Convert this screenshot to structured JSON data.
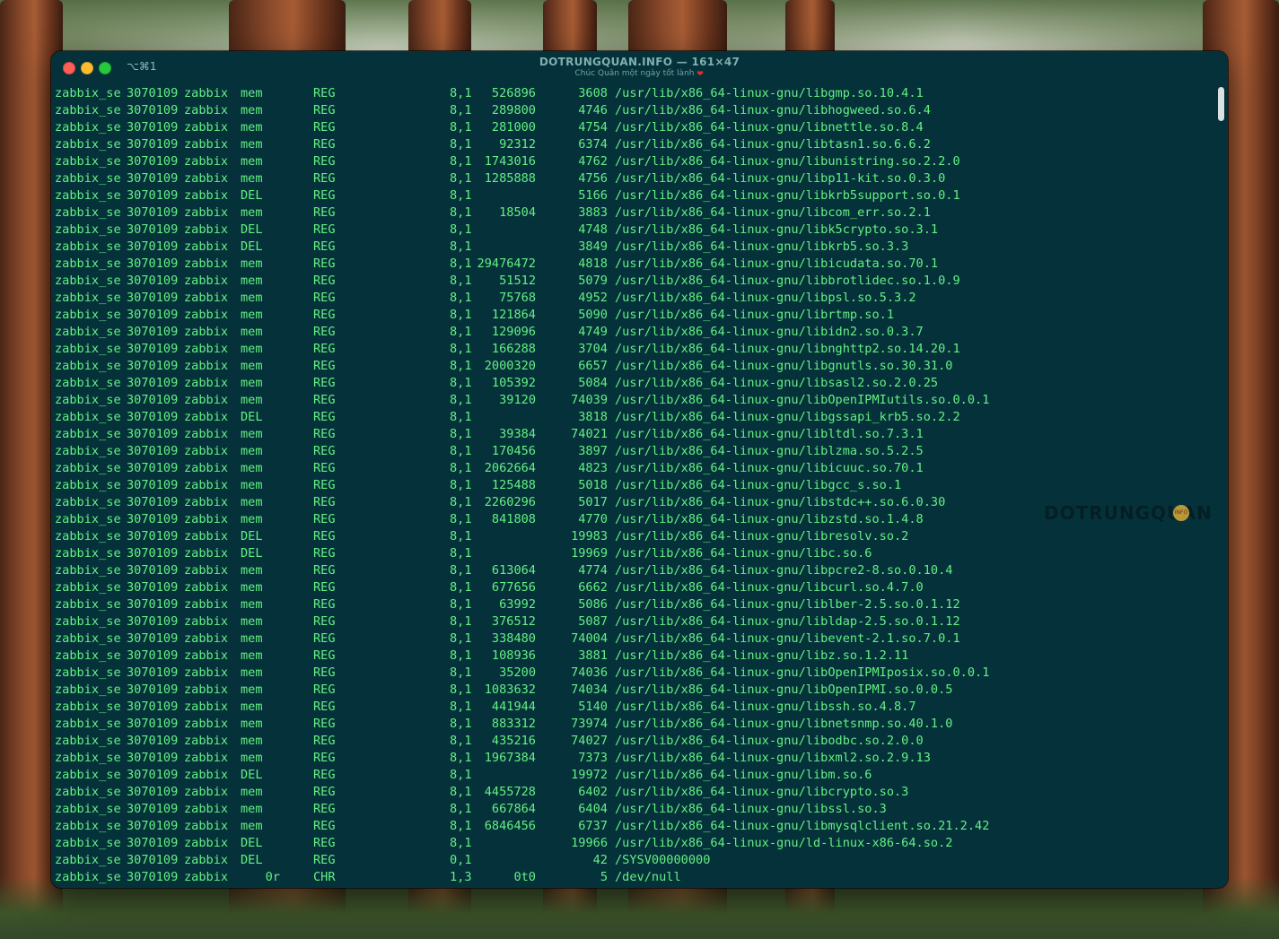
{
  "window": {
    "shortcut": "⌥⌘1",
    "title": "DOTRUNGQUAN.INFO — 161×47",
    "subtitle": "Chúc Quân một ngày tốt lành"
  },
  "watermark": {
    "text": "DOTRUNGQUAN",
    "badge": "INFO"
  },
  "colors": {
    "terminal_bg": "#05323a",
    "terminal_text": "#64f083"
  },
  "rows": [
    {
      "cmd": "zabbix_se",
      "pid": "3070109",
      "user": "zabbix",
      "fd": "mem",
      "type": "REG",
      "dev": "8,1",
      "size": "526896",
      "node": "3608",
      "name": "/usr/lib/x86_64-linux-gnu/libgmp.so.10.4.1"
    },
    {
      "cmd": "zabbix_se",
      "pid": "3070109",
      "user": "zabbix",
      "fd": "mem",
      "type": "REG",
      "dev": "8,1",
      "size": "289800",
      "node": "4746",
      "name": "/usr/lib/x86_64-linux-gnu/libhogweed.so.6.4"
    },
    {
      "cmd": "zabbix_se",
      "pid": "3070109",
      "user": "zabbix",
      "fd": "mem",
      "type": "REG",
      "dev": "8,1",
      "size": "281000",
      "node": "4754",
      "name": "/usr/lib/x86_64-linux-gnu/libnettle.so.8.4"
    },
    {
      "cmd": "zabbix_se",
      "pid": "3070109",
      "user": "zabbix",
      "fd": "mem",
      "type": "REG",
      "dev": "8,1",
      "size": "92312",
      "node": "6374",
      "name": "/usr/lib/x86_64-linux-gnu/libtasn1.so.6.6.2"
    },
    {
      "cmd": "zabbix_se",
      "pid": "3070109",
      "user": "zabbix",
      "fd": "mem",
      "type": "REG",
      "dev": "8,1",
      "size": "1743016",
      "node": "4762",
      "name": "/usr/lib/x86_64-linux-gnu/libunistring.so.2.2.0"
    },
    {
      "cmd": "zabbix_se",
      "pid": "3070109",
      "user": "zabbix",
      "fd": "mem",
      "type": "REG",
      "dev": "8,1",
      "size": "1285888",
      "node": "4756",
      "name": "/usr/lib/x86_64-linux-gnu/libp11-kit.so.0.3.0"
    },
    {
      "cmd": "zabbix_se",
      "pid": "3070109",
      "user": "zabbix",
      "fd": "DEL",
      "type": "REG",
      "dev": "8,1",
      "size": "",
      "node": "5166",
      "name": "/usr/lib/x86_64-linux-gnu/libkrb5support.so.0.1"
    },
    {
      "cmd": "zabbix_se",
      "pid": "3070109",
      "user": "zabbix",
      "fd": "mem",
      "type": "REG",
      "dev": "8,1",
      "size": "18504",
      "node": "3883",
      "name": "/usr/lib/x86_64-linux-gnu/libcom_err.so.2.1"
    },
    {
      "cmd": "zabbix_se",
      "pid": "3070109",
      "user": "zabbix",
      "fd": "DEL",
      "type": "REG",
      "dev": "8,1",
      "size": "",
      "node": "4748",
      "name": "/usr/lib/x86_64-linux-gnu/libk5crypto.so.3.1"
    },
    {
      "cmd": "zabbix_se",
      "pid": "3070109",
      "user": "zabbix",
      "fd": "DEL",
      "type": "REG",
      "dev": "8,1",
      "size": "",
      "node": "3849",
      "name": "/usr/lib/x86_64-linux-gnu/libkrb5.so.3.3"
    },
    {
      "cmd": "zabbix_se",
      "pid": "3070109",
      "user": "zabbix",
      "fd": "mem",
      "type": "REG",
      "dev": "8,1",
      "size": "29476472",
      "node": "4818",
      "name": "/usr/lib/x86_64-linux-gnu/libicudata.so.70.1"
    },
    {
      "cmd": "zabbix_se",
      "pid": "3070109",
      "user": "zabbix",
      "fd": "mem",
      "type": "REG",
      "dev": "8,1",
      "size": "51512",
      "node": "5079",
      "name": "/usr/lib/x86_64-linux-gnu/libbrotlidec.so.1.0.9"
    },
    {
      "cmd": "zabbix_se",
      "pid": "3070109",
      "user": "zabbix",
      "fd": "mem",
      "type": "REG",
      "dev": "8,1",
      "size": "75768",
      "node": "4952",
      "name": "/usr/lib/x86_64-linux-gnu/libpsl.so.5.3.2"
    },
    {
      "cmd": "zabbix_se",
      "pid": "3070109",
      "user": "zabbix",
      "fd": "mem",
      "type": "REG",
      "dev": "8,1",
      "size": "121864",
      "node": "5090",
      "name": "/usr/lib/x86_64-linux-gnu/librtmp.so.1"
    },
    {
      "cmd": "zabbix_se",
      "pid": "3070109",
      "user": "zabbix",
      "fd": "mem",
      "type": "REG",
      "dev": "8,1",
      "size": "129096",
      "node": "4749",
      "name": "/usr/lib/x86_64-linux-gnu/libidn2.so.0.3.7"
    },
    {
      "cmd": "zabbix_se",
      "pid": "3070109",
      "user": "zabbix",
      "fd": "mem",
      "type": "REG",
      "dev": "8,1",
      "size": "166288",
      "node": "3704",
      "name": "/usr/lib/x86_64-linux-gnu/libnghttp2.so.14.20.1"
    },
    {
      "cmd": "zabbix_se",
      "pid": "3070109",
      "user": "zabbix",
      "fd": "mem",
      "type": "REG",
      "dev": "8,1",
      "size": "2000320",
      "node": "6657",
      "name": "/usr/lib/x86_64-linux-gnu/libgnutls.so.30.31.0"
    },
    {
      "cmd": "zabbix_se",
      "pid": "3070109",
      "user": "zabbix",
      "fd": "mem",
      "type": "REG",
      "dev": "8,1",
      "size": "105392",
      "node": "5084",
      "name": "/usr/lib/x86_64-linux-gnu/libsasl2.so.2.0.25"
    },
    {
      "cmd": "zabbix_se",
      "pid": "3070109",
      "user": "zabbix",
      "fd": "mem",
      "type": "REG",
      "dev": "8,1",
      "size": "39120",
      "node": "74039",
      "name": "/usr/lib/x86_64-linux-gnu/libOpenIPMIutils.so.0.0.1"
    },
    {
      "cmd": "zabbix_se",
      "pid": "3070109",
      "user": "zabbix",
      "fd": "DEL",
      "type": "REG",
      "dev": "8,1",
      "size": "",
      "node": "3818",
      "name": "/usr/lib/x86_64-linux-gnu/libgssapi_krb5.so.2.2"
    },
    {
      "cmd": "zabbix_se",
      "pid": "3070109",
      "user": "zabbix",
      "fd": "mem",
      "type": "REG",
      "dev": "8,1",
      "size": "39384",
      "node": "74021",
      "name": "/usr/lib/x86_64-linux-gnu/libltdl.so.7.3.1"
    },
    {
      "cmd": "zabbix_se",
      "pid": "3070109",
      "user": "zabbix",
      "fd": "mem",
      "type": "REG",
      "dev": "8,1",
      "size": "170456",
      "node": "3897",
      "name": "/usr/lib/x86_64-linux-gnu/liblzma.so.5.2.5"
    },
    {
      "cmd": "zabbix_se",
      "pid": "3070109",
      "user": "zabbix",
      "fd": "mem",
      "type": "REG",
      "dev": "8,1",
      "size": "2062664",
      "node": "4823",
      "name": "/usr/lib/x86_64-linux-gnu/libicuuc.so.70.1"
    },
    {
      "cmd": "zabbix_se",
      "pid": "3070109",
      "user": "zabbix",
      "fd": "mem",
      "type": "REG",
      "dev": "8,1",
      "size": "125488",
      "node": "5018",
      "name": "/usr/lib/x86_64-linux-gnu/libgcc_s.so.1"
    },
    {
      "cmd": "zabbix_se",
      "pid": "3070109",
      "user": "zabbix",
      "fd": "mem",
      "type": "REG",
      "dev": "8,1",
      "size": "2260296",
      "node": "5017",
      "name": "/usr/lib/x86_64-linux-gnu/libstdc++.so.6.0.30"
    },
    {
      "cmd": "zabbix_se",
      "pid": "3070109",
      "user": "zabbix",
      "fd": "mem",
      "type": "REG",
      "dev": "8,1",
      "size": "841808",
      "node": "4770",
      "name": "/usr/lib/x86_64-linux-gnu/libzstd.so.1.4.8"
    },
    {
      "cmd": "zabbix_se",
      "pid": "3070109",
      "user": "zabbix",
      "fd": "DEL",
      "type": "REG",
      "dev": "8,1",
      "size": "",
      "node": "19983",
      "name": "/usr/lib/x86_64-linux-gnu/libresolv.so.2"
    },
    {
      "cmd": "zabbix_se",
      "pid": "3070109",
      "user": "zabbix",
      "fd": "DEL",
      "type": "REG",
      "dev": "8,1",
      "size": "",
      "node": "19969",
      "name": "/usr/lib/x86_64-linux-gnu/libc.so.6"
    },
    {
      "cmd": "zabbix_se",
      "pid": "3070109",
      "user": "zabbix",
      "fd": "mem",
      "type": "REG",
      "dev": "8,1",
      "size": "613064",
      "node": "4774",
      "name": "/usr/lib/x86_64-linux-gnu/libpcre2-8.so.0.10.4"
    },
    {
      "cmd": "zabbix_se",
      "pid": "3070109",
      "user": "zabbix",
      "fd": "mem",
      "type": "REG",
      "dev": "8,1",
      "size": "677656",
      "node": "6662",
      "name": "/usr/lib/x86_64-linux-gnu/libcurl.so.4.7.0"
    },
    {
      "cmd": "zabbix_se",
      "pid": "3070109",
      "user": "zabbix",
      "fd": "mem",
      "type": "REG",
      "dev": "8,1",
      "size": "63992",
      "node": "5086",
      "name": "/usr/lib/x86_64-linux-gnu/liblber-2.5.so.0.1.12"
    },
    {
      "cmd": "zabbix_se",
      "pid": "3070109",
      "user": "zabbix",
      "fd": "mem",
      "type": "REG",
      "dev": "8,1",
      "size": "376512",
      "node": "5087",
      "name": "/usr/lib/x86_64-linux-gnu/libldap-2.5.so.0.1.12"
    },
    {
      "cmd": "zabbix_se",
      "pid": "3070109",
      "user": "zabbix",
      "fd": "mem",
      "type": "REG",
      "dev": "8,1",
      "size": "338480",
      "node": "74004",
      "name": "/usr/lib/x86_64-linux-gnu/libevent-2.1.so.7.0.1"
    },
    {
      "cmd": "zabbix_se",
      "pid": "3070109",
      "user": "zabbix",
      "fd": "mem",
      "type": "REG",
      "dev": "8,1",
      "size": "108936",
      "node": "3881",
      "name": "/usr/lib/x86_64-linux-gnu/libz.so.1.2.11"
    },
    {
      "cmd": "zabbix_se",
      "pid": "3070109",
      "user": "zabbix",
      "fd": "mem",
      "type": "REG",
      "dev": "8,1",
      "size": "35200",
      "node": "74036",
      "name": "/usr/lib/x86_64-linux-gnu/libOpenIPMIposix.so.0.0.1"
    },
    {
      "cmd": "zabbix_se",
      "pid": "3070109",
      "user": "zabbix",
      "fd": "mem",
      "type": "REG",
      "dev": "8,1",
      "size": "1083632",
      "node": "74034",
      "name": "/usr/lib/x86_64-linux-gnu/libOpenIPMI.so.0.0.5"
    },
    {
      "cmd": "zabbix_se",
      "pid": "3070109",
      "user": "zabbix",
      "fd": "mem",
      "type": "REG",
      "dev": "8,1",
      "size": "441944",
      "node": "5140",
      "name": "/usr/lib/x86_64-linux-gnu/libssh.so.4.8.7"
    },
    {
      "cmd": "zabbix_se",
      "pid": "3070109",
      "user": "zabbix",
      "fd": "mem",
      "type": "REG",
      "dev": "8,1",
      "size": "883312",
      "node": "73974",
      "name": "/usr/lib/x86_64-linux-gnu/libnetsnmp.so.40.1.0"
    },
    {
      "cmd": "zabbix_se",
      "pid": "3070109",
      "user": "zabbix",
      "fd": "mem",
      "type": "REG",
      "dev": "8,1",
      "size": "435216",
      "node": "74027",
      "name": "/usr/lib/x86_64-linux-gnu/libodbc.so.2.0.0"
    },
    {
      "cmd": "zabbix_se",
      "pid": "3070109",
      "user": "zabbix",
      "fd": "mem",
      "type": "REG",
      "dev": "8,1",
      "size": "1967384",
      "node": "7373",
      "name": "/usr/lib/x86_64-linux-gnu/libxml2.so.2.9.13"
    },
    {
      "cmd": "zabbix_se",
      "pid": "3070109",
      "user": "zabbix",
      "fd": "DEL",
      "type": "REG",
      "dev": "8,1",
      "size": "",
      "node": "19972",
      "name": "/usr/lib/x86_64-linux-gnu/libm.so.6"
    },
    {
      "cmd": "zabbix_se",
      "pid": "3070109",
      "user": "zabbix",
      "fd": "mem",
      "type": "REG",
      "dev": "8,1",
      "size": "4455728",
      "node": "6402",
      "name": "/usr/lib/x86_64-linux-gnu/libcrypto.so.3"
    },
    {
      "cmd": "zabbix_se",
      "pid": "3070109",
      "user": "zabbix",
      "fd": "mem",
      "type": "REG",
      "dev": "8,1",
      "size": "667864",
      "node": "6404",
      "name": "/usr/lib/x86_64-linux-gnu/libssl.so.3"
    },
    {
      "cmd": "zabbix_se",
      "pid": "3070109",
      "user": "zabbix",
      "fd": "mem",
      "type": "REG",
      "dev": "8,1",
      "size": "6846456",
      "node": "6737",
      "name": "/usr/lib/x86_64-linux-gnu/libmysqlclient.so.21.2.42"
    },
    {
      "cmd": "zabbix_se",
      "pid": "3070109",
      "user": "zabbix",
      "fd": "DEL",
      "type": "REG",
      "dev": "8,1",
      "size": "",
      "node": "19966",
      "name": "/usr/lib/x86_64-linux-gnu/ld-linux-x86-64.so.2"
    },
    {
      "cmd": "zabbix_se",
      "pid": "3070109",
      "user": "zabbix",
      "fd": "DEL",
      "type": "REG",
      "dev": "0,1",
      "size": "",
      "node": "42",
      "name": "/SYSV00000000"
    },
    {
      "cmd": "zabbix_se",
      "pid": "3070109",
      "user": "zabbix",
      "fd": "0r",
      "type": "CHR",
      "dev": "1,3",
      "size": "0t0",
      "node": "5",
      "name": "/dev/null"
    }
  ]
}
